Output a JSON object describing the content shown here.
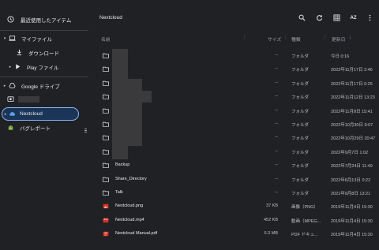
{
  "sidebar": {
    "recent": "最近使用したアイテム",
    "my_files": "マイファイル",
    "downloads": "ダウンロード",
    "play_files": "Play ファイル",
    "google_drive": "Google ドライブ",
    "nextcloud": "Nextcloud",
    "bug_report": "バグレポート"
  },
  "toolbar": {
    "title": "Nextcloud",
    "sort_label": "AZ"
  },
  "columns": {
    "name": "名前",
    "size": "サイズ",
    "type": "種類",
    "date": "更新日",
    "sort_arrow": "↓"
  },
  "rows": [
    {
      "name": "",
      "size": "--",
      "type": "フォルダ",
      "date": "今日 0:16",
      "icon": "folder"
    },
    {
      "name": "",
      "size": "--",
      "type": "フォルダ",
      "date": "2022年11月17日 2:46",
      "icon": "folder"
    },
    {
      "name": "",
      "size": "--",
      "type": "フォルダ",
      "date": "2022年11月17日 0:25",
      "icon": "folder"
    },
    {
      "name": "",
      "size": "--",
      "type": "フォルダ",
      "date": "2022年11月12日 13:23",
      "icon": "folder"
    },
    {
      "name": "",
      "size": "--",
      "type": "フォルダ",
      "date": "2022年11月8日 15:41",
      "icon": "folder"
    },
    {
      "name": "",
      "size": "--",
      "type": "フォルダ",
      "date": "2022年10月30日 9:07",
      "icon": "folder"
    },
    {
      "name": "",
      "size": "--",
      "type": "フォルダ",
      "date": "2022年10月29日 20:47",
      "icon": "folder"
    },
    {
      "name": "",
      "size": "--",
      "type": "フォルダ",
      "date": "2022年9月7日 1:02",
      "icon": "folder"
    },
    {
      "name": "Backup",
      "size": "--",
      "type": "フォルダ",
      "date": "2022年7月24日 11:49",
      "icon": "folder"
    },
    {
      "name": "Share_Directory",
      "size": "--",
      "type": "フォルダ",
      "date": "2022年6月13日 0:22",
      "icon": "folder"
    },
    {
      "name": "Talk",
      "size": "--",
      "type": "フォルダ",
      "date": "2021年9月8日 13:21",
      "icon": "folder"
    },
    {
      "name": "Nextcloud.png",
      "size": "37 KB",
      "type": "画像（PNG）",
      "date": "2019年11月4日 15:30",
      "icon": "image"
    },
    {
      "name": "Nextcloud.mp4",
      "size": "452 KB",
      "type": "動画（MPEG...",
      "date": "2019年11月4日 15:30",
      "icon": "video"
    },
    {
      "name": "Nextcloud Manual.pdf",
      "size": "6.3 MB",
      "type": "PDF ドキュ...",
      "date": "2019年11月4日 15:30",
      "icon": "pdf"
    }
  ]
}
